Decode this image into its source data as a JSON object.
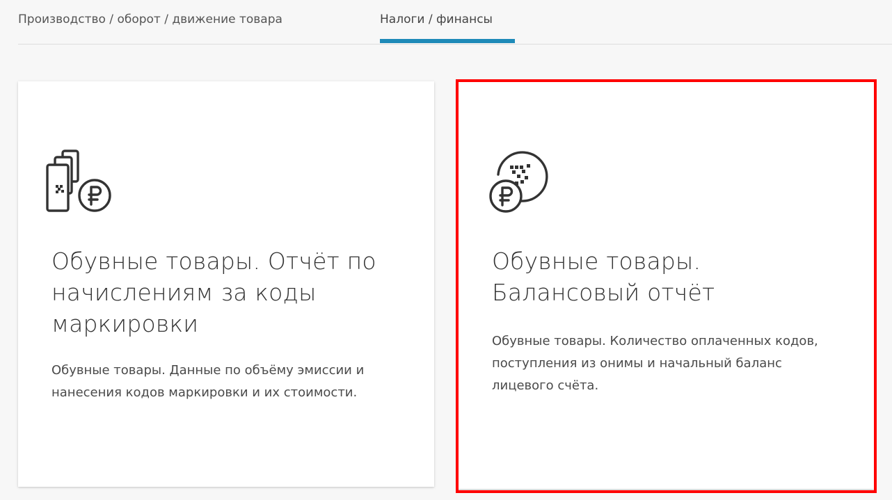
{
  "tabs": [
    {
      "label": "Производство / оборот / движение товара",
      "active": false
    },
    {
      "label": "Налоги / финансы",
      "active": true
    }
  ],
  "accent_color": "#1e8ab8",
  "highlight_color": "#ff0000",
  "cards": [
    {
      "icon": "codes-ruble-icon",
      "title": "Обувные товары. Отчёт по начислениям за коды маркировки",
      "description": "Обувные товары. Данные по объёму эмиссии и нанесения кодов маркировки и их стоимости."
    },
    {
      "icon": "balance-ruble-icon",
      "title": "Обувные товары. Балансовый отчёт",
      "description": "Обувные товары. Количество оплаченных кодов, поступления из онимы и начальный баланс лицевого счёта."
    }
  ]
}
